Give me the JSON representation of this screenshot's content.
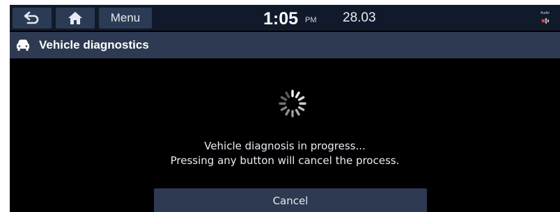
{
  "topbar": {
    "back_icon": "back-arrow-icon",
    "home_icon": "home-icon",
    "menu_label": "Menu",
    "time": "1:05",
    "ampm": "PM",
    "date": "28.03",
    "status_label": "Audio",
    "status_icon": "audio-source-icon"
  },
  "titlebar": {
    "icon": "car-front-icon",
    "title": "Vehicle diagnostics"
  },
  "main": {
    "spinner_icon": "loading-spinner-icon",
    "message_line1": "Vehicle diagnosis in progress...",
    "message_line2": "Pressing any button will cancel the process.",
    "cancel_label": "Cancel"
  },
  "colors": {
    "background": "#000000",
    "topbar": "#111a2b",
    "button": "#2c3b55",
    "titlebar": "#2d3a51",
    "text": "#e8ecf2"
  }
}
